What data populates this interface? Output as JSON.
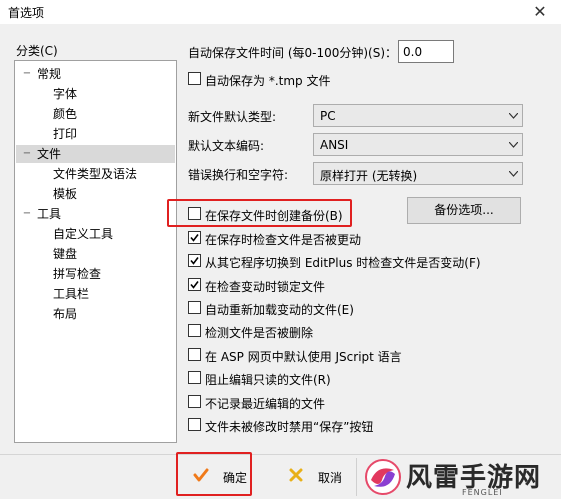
{
  "window": {
    "title": "首选项",
    "close_glyph": "✕"
  },
  "category": {
    "label": "分类(C)",
    "items": [
      {
        "label": "常规",
        "level": 0,
        "marker": "−"
      },
      {
        "label": "字体",
        "level": 1
      },
      {
        "label": "颜色",
        "level": 1
      },
      {
        "label": "打印",
        "level": 1
      },
      {
        "label": "文件",
        "level": 0,
        "marker": "−",
        "selected": true
      },
      {
        "label": "文件类型及语法",
        "level": 1
      },
      {
        "label": "模板",
        "level": 1
      },
      {
        "label": "工具",
        "level": 0,
        "marker": "−"
      },
      {
        "label": "自定义工具",
        "level": 1
      },
      {
        "label": "键盘",
        "level": 1
      },
      {
        "label": "拼写检查",
        "level": 1
      },
      {
        "label": "工具栏",
        "level": 1
      },
      {
        "label": "布局",
        "level": 1
      }
    ]
  },
  "autosave": {
    "label": "自动保存文件时间 (每0-100分钟)(S)：",
    "value": "0.0"
  },
  "autosave_tmp": {
    "label": "自动保存为 *.tmp 文件",
    "checked": false
  },
  "new_file_type": {
    "label": "新文件默认类型:",
    "value": "PC"
  },
  "default_encoding": {
    "label": "默认文本编码:",
    "value": "ANSI"
  },
  "wrap_whitespace": {
    "label": "错误换行和空字符:",
    "value": "原样打开 (无转换)"
  },
  "backup_options_button": "备份选项...",
  "checkboxes": [
    {
      "label": "在保存文件时创建备份(B)",
      "checked": false,
      "highlighted": true
    },
    {
      "label": "在保存时检查文件是否被更动",
      "checked": true
    },
    {
      "label": "从其它程序切换到 EditPlus 时检查文件是否变动(F)",
      "checked": true
    },
    {
      "label": "在检查变动时锁定文件",
      "checked": true
    },
    {
      "label": "自动重新加载变动的文件(E)",
      "checked": false
    },
    {
      "label": "检测文件是否被删除",
      "checked": false
    },
    {
      "label": "在 ASP 网页中默认使用 JScript 语言",
      "checked": false
    },
    {
      "label": "阻止编辑只读的文件(R)",
      "checked": false
    },
    {
      "label": "不记录最近编辑的文件",
      "checked": false
    },
    {
      "label": "文件未被修改时禁用“保存”按钮",
      "checked": false
    }
  ],
  "footer": {
    "ok_label": "确定",
    "cancel_label": "取消",
    "brand_text": "风雷手游网",
    "brand_sub": "FENGLEI"
  },
  "colors": {
    "highlight": "#e02020",
    "ok_icon": "#f07a1a",
    "cancel_icon": "#e8b018"
  }
}
